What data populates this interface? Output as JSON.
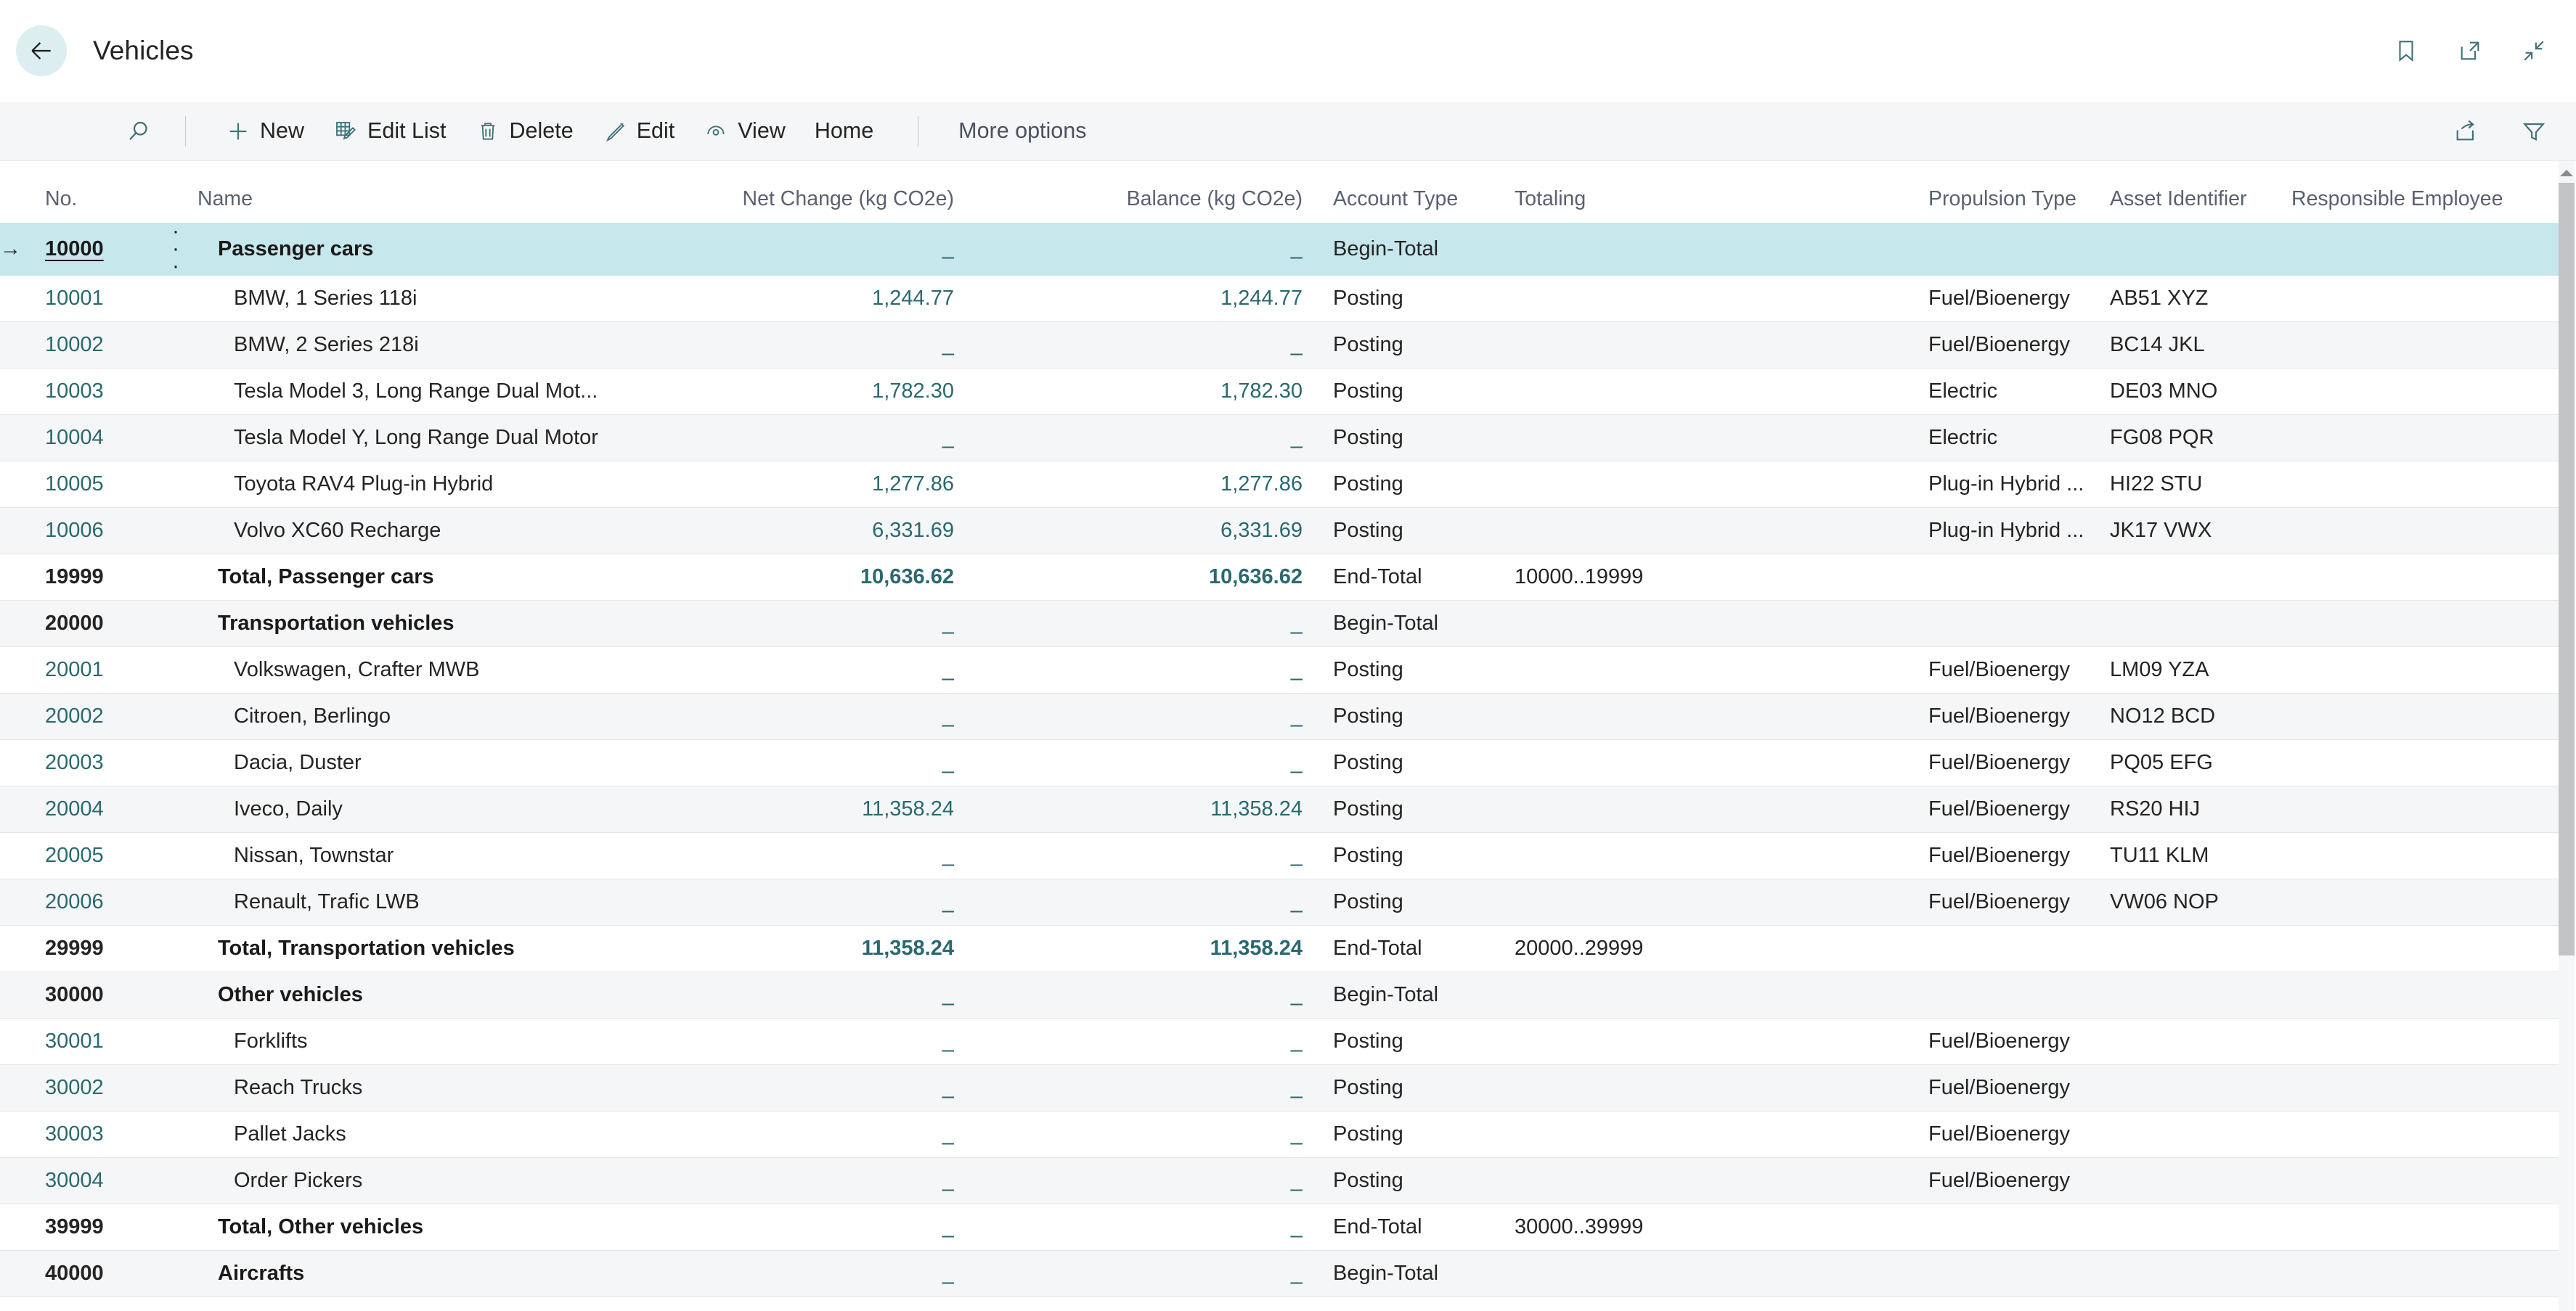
{
  "titlebar": {
    "back_label": "Back",
    "title": "Vehicles",
    "actions": [
      {
        "name": "bookmark-icon",
        "label": "Bookmark"
      },
      {
        "name": "open-in-new-window-icon",
        "label": "Open in new window"
      },
      {
        "name": "collapse-icon",
        "label": "Collapse"
      }
    ]
  },
  "commandbar": {
    "search_label": "Search",
    "items": [
      {
        "icon": "plus-icon",
        "label": "New"
      },
      {
        "icon": "edit-list-icon",
        "label": "Edit List"
      },
      {
        "icon": "trash-icon",
        "label": "Delete"
      },
      {
        "icon": "pencil-icon",
        "label": "Edit"
      },
      {
        "icon": "eye-icon",
        "label": "View"
      },
      {
        "icon": "none",
        "label": "Home"
      }
    ],
    "more_options": "More options",
    "right_actions": [
      {
        "name": "share-icon",
        "label": "Share"
      },
      {
        "name": "filter-icon",
        "label": "Filter"
      }
    ]
  },
  "table": {
    "columns": [
      {
        "key": "no",
        "label": "No."
      },
      {
        "key": "name",
        "label": "Name"
      },
      {
        "key": "net_change",
        "label": "Net Change (kg CO2e)"
      },
      {
        "key": "balance",
        "label": "Balance (kg CO2e)"
      },
      {
        "key": "account_type",
        "label": "Account Type"
      },
      {
        "key": "totaling",
        "label": "Totaling"
      },
      {
        "key": "propulsion_type",
        "label": "Propulsion Type"
      },
      {
        "key": "asset_identifier",
        "label": "Asset Identifier"
      },
      {
        "key": "responsible_employee",
        "label": "Responsible Employee"
      }
    ],
    "row_menu_glyph": "⋮",
    "selected_indicator": "→",
    "empty_value": "–",
    "rows": [
      {
        "no": "10000",
        "name": "Passenger cars",
        "net_change": "–",
        "balance": "–",
        "account_type": "Begin-Total",
        "totaling": "",
        "propulsion_type": "",
        "asset_identifier": "",
        "responsible_employee": "",
        "style": "group",
        "selected": true
      },
      {
        "no": "10001",
        "name": "BMW, 1 Series 118i",
        "net_change": "1,244.77",
        "balance": "1,244.77",
        "account_type": "Posting",
        "totaling": "",
        "propulsion_type": "Fuel/Bioenergy",
        "asset_identifier": "AB51 XYZ",
        "responsible_employee": "",
        "style": "posting"
      },
      {
        "no": "10002",
        "name": "BMW, 2 Series 218i",
        "net_change": "–",
        "balance": "–",
        "account_type": "Posting",
        "totaling": "",
        "propulsion_type": "Fuel/Bioenergy",
        "asset_identifier": "BC14 JKL",
        "responsible_employee": "",
        "style": "posting"
      },
      {
        "no": "10003",
        "name": "Tesla Model 3, Long Range Dual Mot...",
        "net_change": "1,782.30",
        "balance": "1,782.30",
        "account_type": "Posting",
        "totaling": "",
        "propulsion_type": "Electric",
        "asset_identifier": "DE03 MNO",
        "responsible_employee": "",
        "style": "posting"
      },
      {
        "no": "10004",
        "name": "Tesla Model Y, Long Range Dual Motor",
        "net_change": "–",
        "balance": "–",
        "account_type": "Posting",
        "totaling": "",
        "propulsion_type": "Electric",
        "asset_identifier": "FG08 PQR",
        "responsible_employee": "",
        "style": "posting"
      },
      {
        "no": "10005",
        "name": "Toyota RAV4 Plug-in Hybrid",
        "net_change": "1,277.86",
        "balance": "1,277.86",
        "account_type": "Posting",
        "totaling": "",
        "propulsion_type": "Plug-in Hybrid ...",
        "asset_identifier": "HI22 STU",
        "responsible_employee": "",
        "style": "posting"
      },
      {
        "no": "10006",
        "name": "Volvo XC60 Recharge",
        "net_change": "6,331.69",
        "balance": "6,331.69",
        "account_type": "Posting",
        "totaling": "",
        "propulsion_type": "Plug-in Hybrid ...",
        "asset_identifier": "JK17 VWX",
        "responsible_employee": "",
        "style": "posting"
      },
      {
        "no": "19999",
        "name": "Total, Passenger cars",
        "net_change": "10,636.62",
        "balance": "10,636.62",
        "account_type": "End-Total",
        "totaling": "10000..19999",
        "propulsion_type": "",
        "asset_identifier": "",
        "responsible_employee": "",
        "style": "total"
      },
      {
        "no": "20000",
        "name": "Transportation vehicles",
        "net_change": "–",
        "balance": "–",
        "account_type": "Begin-Total",
        "totaling": "",
        "propulsion_type": "",
        "asset_identifier": "",
        "responsible_employee": "",
        "style": "group"
      },
      {
        "no": "20001",
        "name": "Volkswagen, Crafter MWB",
        "net_change": "–",
        "balance": "–",
        "account_type": "Posting",
        "totaling": "",
        "propulsion_type": "Fuel/Bioenergy",
        "asset_identifier": "LM09 YZA",
        "responsible_employee": "",
        "style": "posting"
      },
      {
        "no": "20002",
        "name": "Citroen, Berlingo",
        "net_change": "–",
        "balance": "–",
        "account_type": "Posting",
        "totaling": "",
        "propulsion_type": "Fuel/Bioenergy",
        "asset_identifier": "NO12 BCD",
        "responsible_employee": "",
        "style": "posting"
      },
      {
        "no": "20003",
        "name": "Dacia, Duster",
        "net_change": "–",
        "balance": "–",
        "account_type": "Posting",
        "totaling": "",
        "propulsion_type": "Fuel/Bioenergy",
        "asset_identifier": "PQ05 EFG",
        "responsible_employee": "",
        "style": "posting"
      },
      {
        "no": "20004",
        "name": "Iveco, Daily",
        "net_change": "11,358.24",
        "balance": "11,358.24",
        "account_type": "Posting",
        "totaling": "",
        "propulsion_type": "Fuel/Bioenergy",
        "asset_identifier": "RS20 HIJ",
        "responsible_employee": "",
        "style": "posting"
      },
      {
        "no": "20005",
        "name": "Nissan, Townstar",
        "net_change": "–",
        "balance": "–",
        "account_type": "Posting",
        "totaling": "",
        "propulsion_type": "Fuel/Bioenergy",
        "asset_identifier": "TU11 KLM",
        "responsible_employee": "",
        "style": "posting"
      },
      {
        "no": "20006",
        "name": "Renault, Trafic LWB",
        "net_change": "–",
        "balance": "–",
        "account_type": "Posting",
        "totaling": "",
        "propulsion_type": "Fuel/Bioenergy",
        "asset_identifier": "VW06 NOP",
        "responsible_employee": "",
        "style": "posting"
      },
      {
        "no": "29999",
        "name": "Total, Transportation vehicles",
        "net_change": "11,358.24",
        "balance": "11,358.24",
        "account_type": "End-Total",
        "totaling": "20000..29999",
        "propulsion_type": "",
        "asset_identifier": "",
        "responsible_employee": "",
        "style": "total"
      },
      {
        "no": "30000",
        "name": "Other vehicles",
        "net_change": "–",
        "balance": "–",
        "account_type": "Begin-Total",
        "totaling": "",
        "propulsion_type": "",
        "asset_identifier": "",
        "responsible_employee": "",
        "style": "group"
      },
      {
        "no": "30001",
        "name": "Forklifts",
        "net_change": "–",
        "balance": "–",
        "account_type": "Posting",
        "totaling": "",
        "propulsion_type": "Fuel/Bioenergy",
        "asset_identifier": "",
        "responsible_employee": "",
        "style": "posting"
      },
      {
        "no": "30002",
        "name": "Reach Trucks",
        "net_change": "–",
        "balance": "–",
        "account_type": "Posting",
        "totaling": "",
        "propulsion_type": "Fuel/Bioenergy",
        "asset_identifier": "",
        "responsible_employee": "",
        "style": "posting"
      },
      {
        "no": "30003",
        "name": "Pallet Jacks",
        "net_change": "–",
        "balance": "–",
        "account_type": "Posting",
        "totaling": "",
        "propulsion_type": "Fuel/Bioenergy",
        "asset_identifier": "",
        "responsible_employee": "",
        "style": "posting"
      },
      {
        "no": "30004",
        "name": "Order Pickers",
        "net_change": "–",
        "balance": "–",
        "account_type": "Posting",
        "totaling": "",
        "propulsion_type": "Fuel/Bioenergy",
        "asset_identifier": "",
        "responsible_employee": "",
        "style": "posting"
      },
      {
        "no": "39999",
        "name": "Total, Other vehicles",
        "net_change": "–",
        "balance": "–",
        "account_type": "End-Total",
        "totaling": "30000..39999",
        "propulsion_type": "",
        "asset_identifier": "",
        "responsible_employee": "",
        "style": "total"
      },
      {
        "no": "40000",
        "name": "Aircrafts",
        "net_change": "–",
        "balance": "–",
        "account_type": "Begin-Total",
        "totaling": "",
        "propulsion_type": "",
        "asset_identifier": "",
        "responsible_employee": "",
        "style": "group"
      }
    ]
  },
  "colors": {
    "accent_teal": "#29696f",
    "selected_row": "#c6e8ec",
    "command_bar_bg": "#f5f6f7",
    "band_row": "#f5f6f7",
    "text": "#252423"
  }
}
